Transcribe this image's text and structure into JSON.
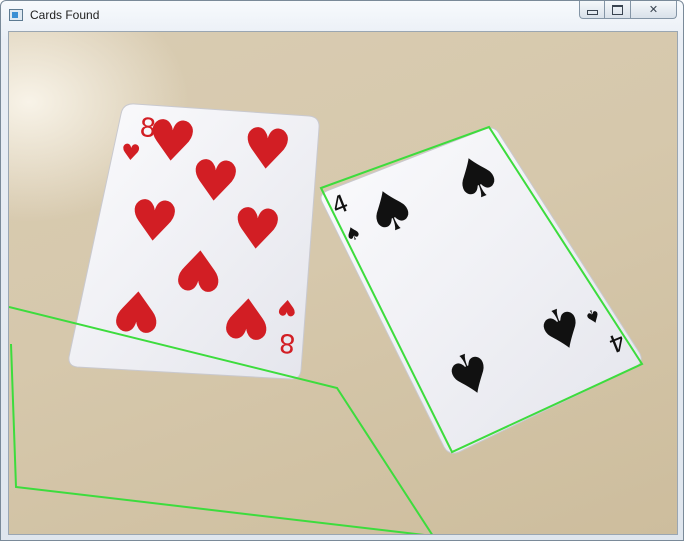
{
  "window": {
    "title": "Cards Found",
    "app_icon": "window-app-icon",
    "controls": {
      "minimize_icon": "minimize-icon",
      "maximize_icon": "maximize-icon",
      "close_icon": "close-icon",
      "close_glyph": "✕"
    }
  },
  "image": {
    "cards": [
      {
        "rank": "8",
        "suit": "♥",
        "suit_name": "hearts",
        "color": "#d21e24",
        "detected": false
      },
      {
        "rank": "4",
        "suit": "♠",
        "suit_name": "spades",
        "color": "#111111",
        "detected": true
      }
    ],
    "detection_color": "#3ddc3d",
    "table_color": "#d6c8ac"
  }
}
